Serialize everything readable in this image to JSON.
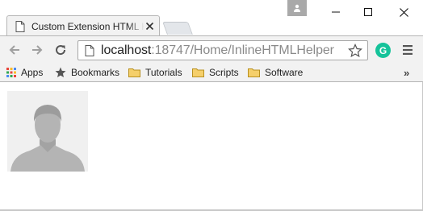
{
  "tab": {
    "title": "Custom Extension HTML Helper"
  },
  "address_bar": {
    "host": "localhost",
    "path": ":18747/Home/InlineHTMLHelper"
  },
  "extension": {
    "letter": "G",
    "color": "#15c39a"
  },
  "bookmarks": {
    "items": [
      {
        "label": "Apps",
        "icon": "apps-grid-icon"
      },
      {
        "label": "Bookmarks",
        "icon": "star-icon"
      },
      {
        "label": "Tutorials",
        "icon": "folder-icon"
      },
      {
        "label": "Scripts",
        "icon": "folder-icon"
      },
      {
        "label": "Software",
        "icon": "folder-icon"
      }
    ],
    "overflow": "»"
  },
  "content": {
    "image": "default-user-avatar"
  }
}
